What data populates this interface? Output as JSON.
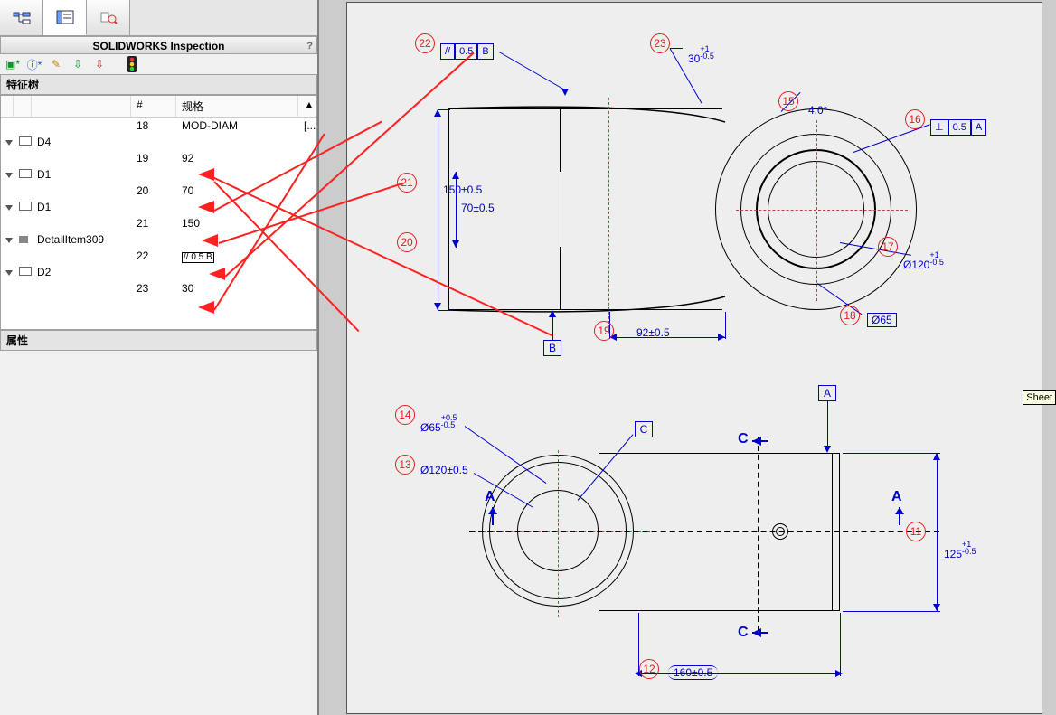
{
  "panel": {
    "title": "SOLIDWORKS Inspection",
    "help": "?",
    "section_tree": "特征树",
    "section_props": "属性",
    "columns": {
      "num": "#",
      "spec": "规格"
    },
    "rows": [
      {
        "type": "data",
        "num": "18",
        "spec": "MOD-DIAM",
        "end": "[..."
      },
      {
        "type": "node",
        "label": "D4"
      },
      {
        "type": "data",
        "num": "19",
        "spec": "92"
      },
      {
        "type": "node",
        "label": "D1"
      },
      {
        "type": "data",
        "num": "20",
        "spec": "70"
      },
      {
        "type": "node",
        "label": "D1"
      },
      {
        "type": "data",
        "num": "21",
        "spec": "150"
      },
      {
        "type": "node",
        "label": "DetailItem309",
        "detail": true
      },
      {
        "type": "data",
        "num": "22",
        "spec_gtol": "// 0.5 B"
      },
      {
        "type": "node",
        "label": "D2"
      },
      {
        "type": "data",
        "num": "23",
        "spec": "30"
      }
    ]
  },
  "balloons": {
    "11": "11",
    "12": "12",
    "13": "13",
    "14": "14",
    "15": "15",
    "16": "16",
    "17": "17",
    "18": "18",
    "19": "19",
    "20": "20",
    "21": "21",
    "22": "22",
    "23": "23"
  },
  "dims": {
    "d30": "30",
    "d30_upper": "+1",
    "d30_lower": "-0.5",
    "d4deg": "4.0°",
    "d150": "150±0.5",
    "d70": "70±0.5",
    "d92": "92±0.5",
    "d120tol": "Ø120",
    "d120_upper": "+1",
    "d120_lower": "-0.5",
    "d65": "Ø65",
    "d65tol": "Ø65",
    "d65_upper": "+0.5",
    "d65_lower": "-0.5",
    "d120b": "Ø120±0.5",
    "d160": "160±0.5",
    "d125": "125",
    "d125_upper": "+1",
    "d125_lower": "-0.5"
  },
  "fcf": {
    "par_sym": "//",
    "par_val": "0.5",
    "par_ref": "B",
    "perp_sym": "⊥",
    "perp_val": "0.5",
    "perp_ref": "A"
  },
  "datums": {
    "A": "A",
    "B": "B",
    "C": "C"
  },
  "section": {
    "A": "A",
    "C": "C"
  },
  "sheet_label": "Sheet"
}
